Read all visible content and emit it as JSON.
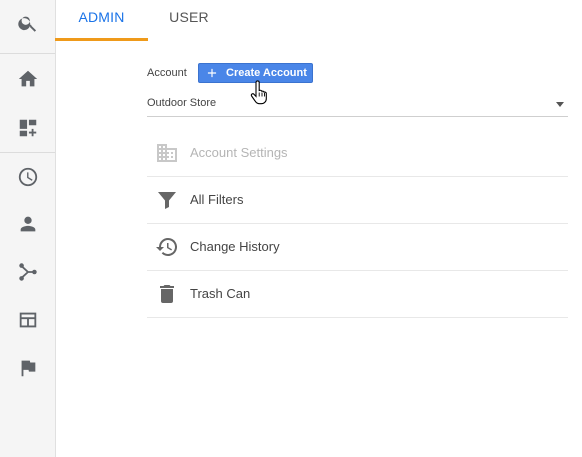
{
  "sidebar": {
    "items": [
      {
        "icon": "search-icon"
      },
      {
        "icon": "home-icon"
      },
      {
        "icon": "customization-icon"
      },
      {
        "icon": "clock-icon"
      },
      {
        "icon": "person-icon"
      },
      {
        "icon": "acquisition-icon"
      },
      {
        "icon": "behavior-icon"
      },
      {
        "icon": "flag-icon"
      }
    ]
  },
  "tabs": {
    "admin": "ADMIN",
    "user": "USER",
    "active": "admin",
    "underline_color": "#ef9a1a"
  },
  "account": {
    "label": "Account",
    "create_button_label": "Create Account",
    "selected": "Outdoor Store",
    "button_color": "#4a86e8"
  },
  "menu": {
    "items": [
      {
        "label": "Account Settings",
        "icon": "building-icon",
        "disabled": true
      },
      {
        "label": "All Filters",
        "icon": "filter-icon",
        "disabled": false
      },
      {
        "label": "Change History",
        "icon": "history-icon",
        "disabled": false
      },
      {
        "label": "Trash Can",
        "icon": "trash-icon",
        "disabled": false
      }
    ]
  }
}
